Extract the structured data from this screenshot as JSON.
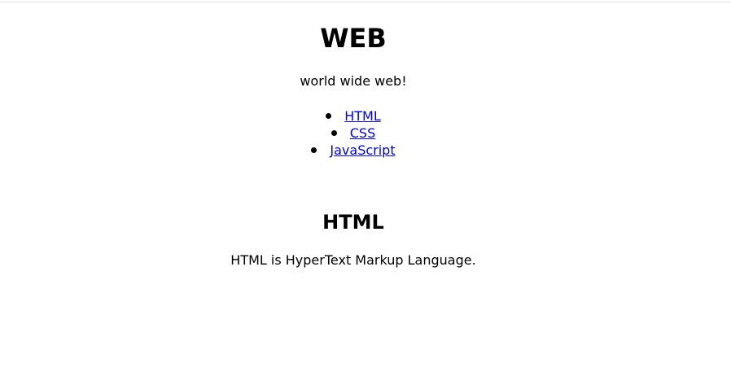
{
  "page": {
    "title": "WEB",
    "subtitle": "world wide web!",
    "nav": {
      "links": [
        {
          "label": "HTML"
        },
        {
          "label": "CSS"
        },
        {
          "label": "JavaScript"
        }
      ]
    }
  },
  "section_html": {
    "heading": "HTML",
    "text": "HTML is HyperText Markup Language."
  },
  "colors": {
    "link": "#0000ee",
    "text": "#000000",
    "divider": "#e3e3e3"
  }
}
